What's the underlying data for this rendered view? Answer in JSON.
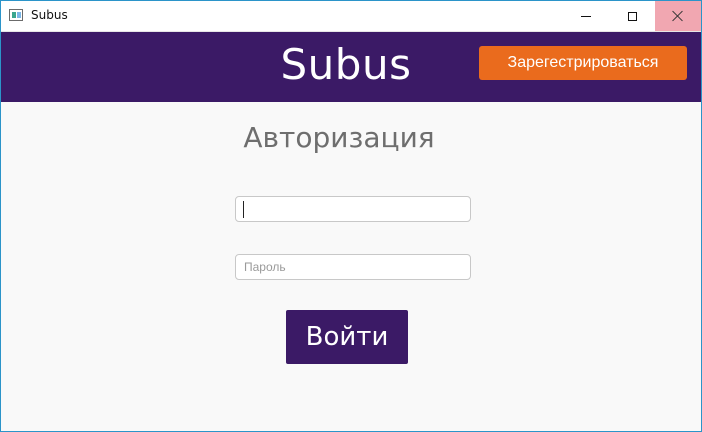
{
  "window": {
    "title": "Subus",
    "icon": "app-window-icon",
    "controls": [
      "minimize-icon",
      "maximize-icon",
      "close-icon"
    ]
  },
  "header": {
    "brand": "Subus",
    "register_label": "Зарегестрироваться"
  },
  "auth": {
    "title": "Авторизация",
    "login_value": "",
    "login_placeholder": "",
    "password_placeholder": "Пароль",
    "submit_label": "Войти"
  },
  "colors": {
    "header_bg": "#3b1a66",
    "accent_orange": "#ea6b1d",
    "submit_bg": "#3b1a66",
    "body_bg": "#f9f9f9",
    "close_hover": "#f1a7b1"
  }
}
